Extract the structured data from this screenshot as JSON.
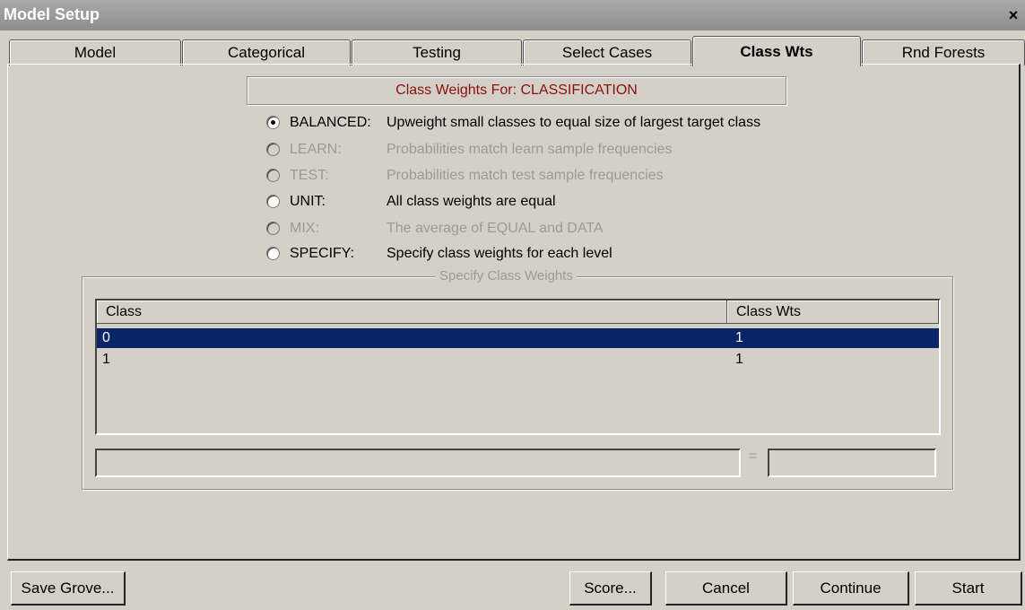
{
  "window": {
    "title": "Model Setup",
    "close_glyph": "×"
  },
  "tabs": [
    {
      "label": "Model"
    },
    {
      "label": "Categorical"
    },
    {
      "label": "Testing"
    },
    {
      "label": "Select Cases"
    },
    {
      "label": "Class Wts",
      "active": true
    },
    {
      "label": "Rnd Forests"
    }
  ],
  "heading": "Class Weights For: CLASSIFICATION",
  "options": [
    {
      "label": "BALANCED:",
      "description": "Upweight small classes to equal size of largest target class",
      "selected": true,
      "enabled": true
    },
    {
      "label": "LEARN:",
      "description": "Probabilities match learn sample frequencies",
      "selected": false,
      "enabled": false
    },
    {
      "label": "TEST:",
      "description": "Probabilities match test sample frequencies",
      "selected": false,
      "enabled": false
    },
    {
      "label": "UNIT:",
      "description": "All class weights are equal",
      "selected": false,
      "enabled": true
    },
    {
      "label": "MIX:",
      "description": "The average of EQUAL and DATA",
      "selected": false,
      "enabled": false
    },
    {
      "label": "SPECIFY:",
      "description": "Specify class weights for each level",
      "selected": false,
      "enabled": true
    }
  ],
  "specify_group": {
    "title": "Specify Class Weights",
    "columns": [
      "Class",
      "Class Wts"
    ],
    "rows": [
      {
        "class": "0",
        "weight": "1",
        "selected": true
      },
      {
        "class": "1",
        "weight": "1",
        "selected": false
      }
    ],
    "edit_class_value": "",
    "equals_sign": "=",
    "edit_weight_value": ""
  },
  "buttons": {
    "save_grove": "Save Grove...",
    "score": "Score...",
    "cancel": "Cancel",
    "continue": "Continue",
    "start": "Start"
  }
}
